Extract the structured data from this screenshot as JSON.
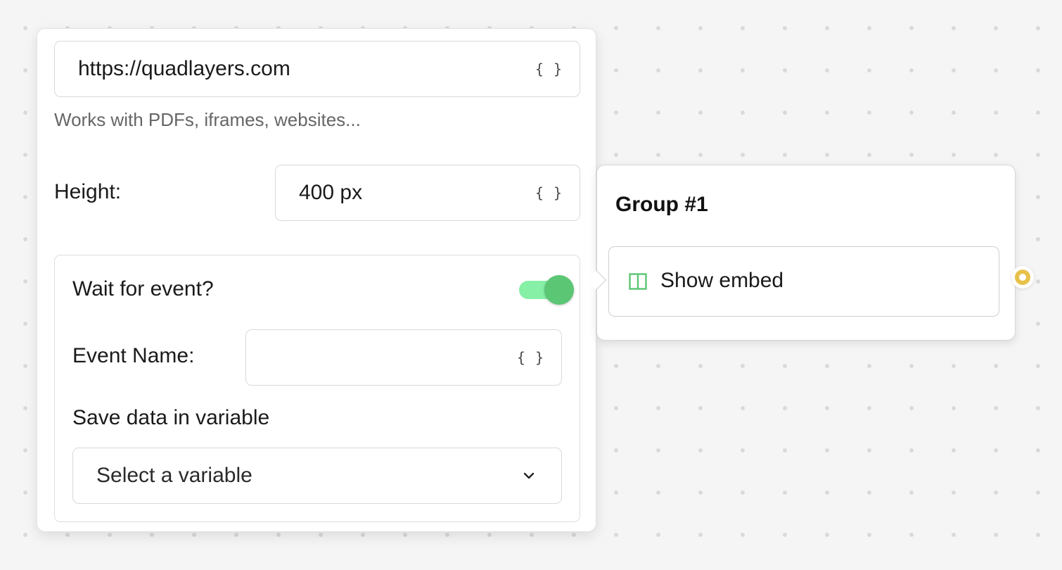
{
  "settings": {
    "url": {
      "value": "https://quadlayers.com",
      "var_button": "{ }"
    },
    "helper_text": "Works with PDFs, iframes, websites...",
    "height": {
      "label": "Height:",
      "value": "400 px",
      "var_button": "{ }"
    },
    "wait_for_event": {
      "label": "Wait for event?",
      "enabled": true,
      "event_name_label": "Event Name:",
      "event_name_value": "",
      "event_name_var_button": "{ }",
      "save_label": "Save data in variable",
      "select_value": "Select a variable"
    }
  },
  "group": {
    "title": "Group #1",
    "block": {
      "label": "Show embed",
      "icon": "embed-icon"
    }
  },
  "colors": {
    "toggle_track": "#86f0a6",
    "toggle_knob": "#5bc674",
    "embed_icon": "#5bc674",
    "connector": "#e7c14a"
  }
}
